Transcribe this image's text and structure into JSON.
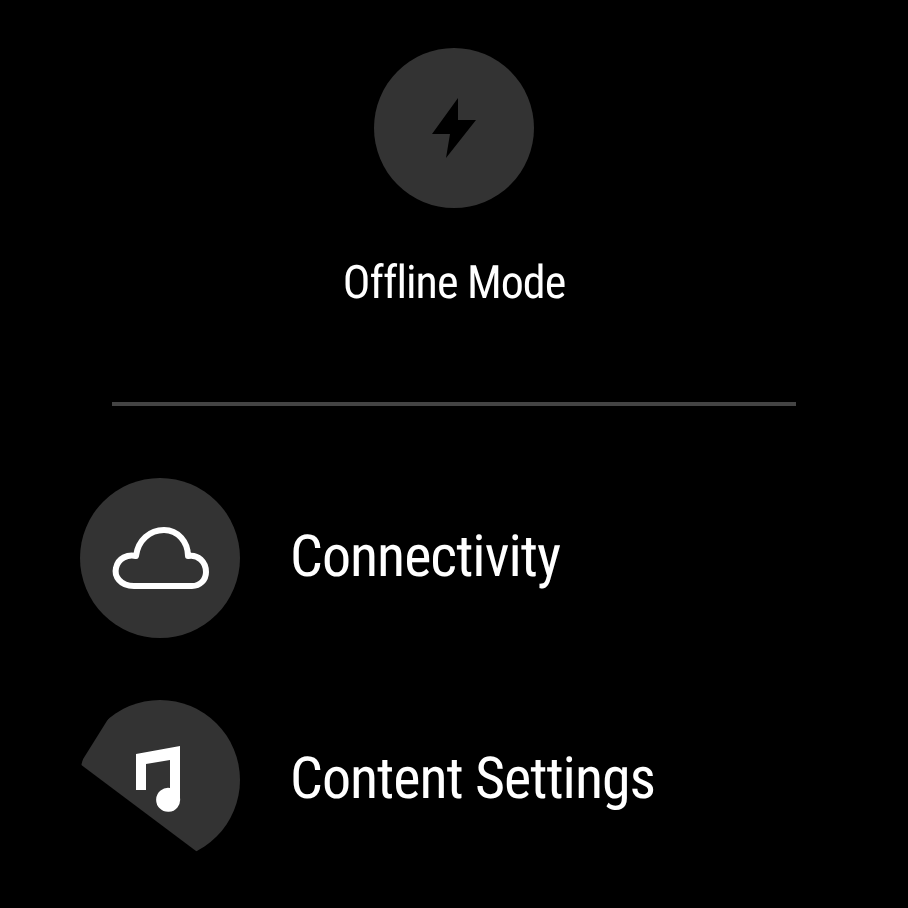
{
  "quick_action": {
    "label": "Offline Mode"
  },
  "items": [
    {
      "label": "Connectivity"
    },
    {
      "label": "Content Settings"
    }
  ]
}
